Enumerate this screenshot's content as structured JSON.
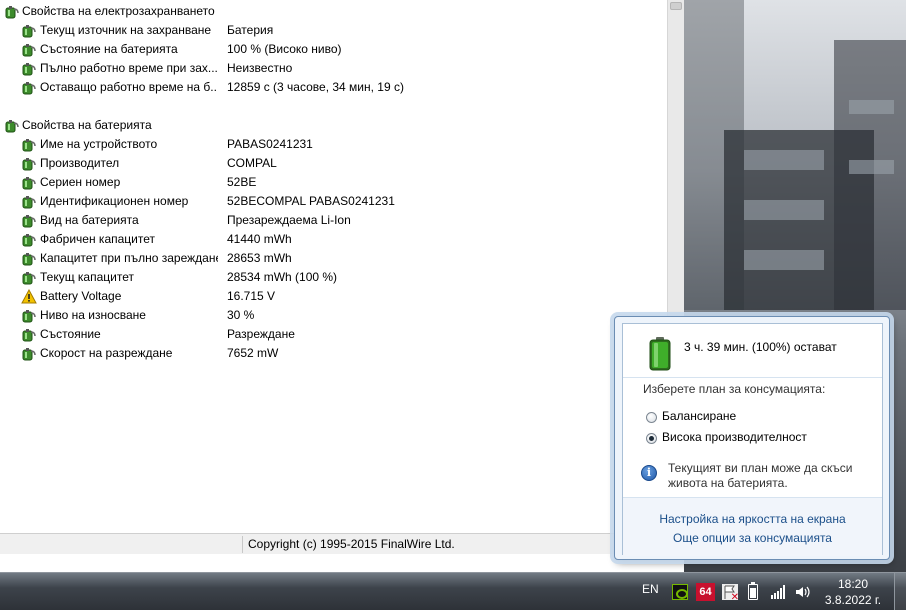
{
  "power_section": {
    "title": "Свойства на електрозахранването",
    "items": [
      {
        "label": "Текущ източник на захранване",
        "value": "Батерия",
        "icon": "battery-tree-icon"
      },
      {
        "label": "Състояние на батерията",
        "value": "100 % (Високо ниво)",
        "icon": "battery-tree-icon"
      },
      {
        "label": "Пълно работно време при зах...",
        "value": "Неизвестно",
        "icon": "battery-tree-icon"
      },
      {
        "label": "Оставащо работно време на б...",
        "value": "12859 с (3 часове, 34 мин, 19 с)",
        "icon": "battery-tree-icon"
      }
    ]
  },
  "battery_section": {
    "title": "Свойства на батерията",
    "items": [
      {
        "label": "Име на устройството",
        "value": "PABAS0241231",
        "icon": "battery-tree-icon"
      },
      {
        "label": "Производител",
        "value": "COMPAL",
        "icon": "battery-tree-icon"
      },
      {
        "label": "Сериен номер",
        "value": "52BE",
        "icon": "battery-tree-icon"
      },
      {
        "label": "Идентификационен номер",
        "value": "52BECOMPAL PABAS0241231",
        "icon": "battery-tree-icon"
      },
      {
        "label": "Вид на батерията",
        "value": "Презареждаема Li-Ion",
        "icon": "battery-tree-icon"
      },
      {
        "label": "Фабричен капацитет",
        "value": "41440 mWh",
        "icon": "battery-tree-icon"
      },
      {
        "label": "Капацитет при пълно зареждане",
        "value": "28653 mWh",
        "icon": "battery-tree-icon"
      },
      {
        "label": "Текущ капацитет",
        "value": "28534 mWh  (100 %)",
        "icon": "battery-tree-icon"
      },
      {
        "label": "Battery Voltage",
        "value": "16.715 V",
        "icon": "warning-icon"
      },
      {
        "label": "Ниво на износване",
        "value": "30 %",
        "icon": "battery-tree-icon"
      },
      {
        "label": "Състояние",
        "value": "Разреждане",
        "icon": "battery-tree-icon"
      },
      {
        "label": "Скорост на разреждане",
        "value": "7652 mW",
        "icon": "battery-tree-icon"
      }
    ]
  },
  "statusbar": {
    "left": "",
    "copyright": "Copyright (c) 1995-2015 FinalWire Ltd."
  },
  "battery_popup": {
    "status": "3 ч. 39 мин. (100%) остават",
    "charge_fraction": 1.0,
    "plan_heading": "Изберете план за консумацията:",
    "plans": [
      {
        "label": "Балансиране",
        "selected": false
      },
      {
        "label": "Висока производителност",
        "selected": true
      }
    ],
    "info": "Текущият ви план може да скъси живота на батерията.",
    "link_brightness": "Настройка на яркостта на екрана",
    "link_more": "Още опции за консумацията"
  },
  "taskbar": {
    "language": "EN",
    "aida_badge": "64",
    "time": "18:20",
    "date": "3.8.2022 г.",
    "tray_icons": [
      "nvidia-icon",
      "aida64-icon",
      "action-center-flag-icon",
      "battery-icon",
      "network-signal-icon",
      "volume-icon"
    ]
  },
  "colors": {
    "link": "#1b4f8a",
    "battery_green": "#3fae2a",
    "popup_border": "#6b8db3",
    "aida_red": "#c8102e"
  }
}
